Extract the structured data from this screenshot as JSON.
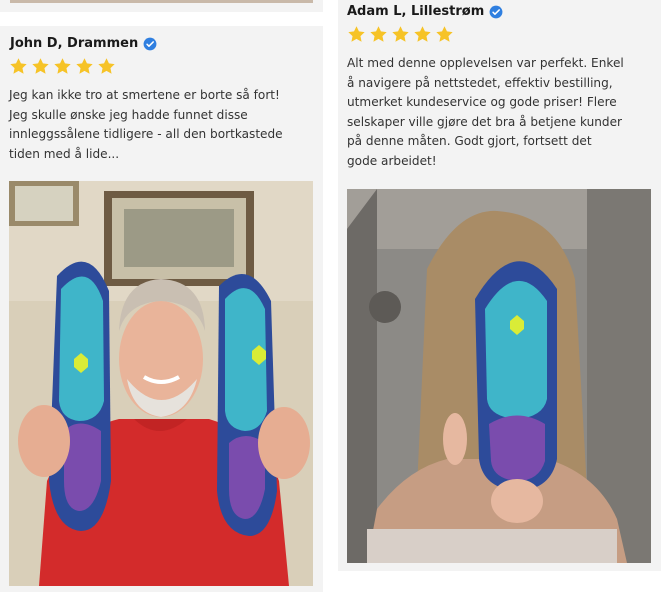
{
  "colors": {
    "card_bg": "#f3f3f3",
    "star": "#f6c327",
    "verified_badge": "#2f7fe0",
    "text": "#333333"
  },
  "reviews": [
    {
      "name": "John D, Drammen",
      "rating": 5,
      "verified_icon": "verified-badge-icon",
      "lines": [
        "Jeg kan ikke tro at smertene er borte så fort!",
        "Jeg skulle ønske jeg hadde funnet disse",
        "innleggssålene tidligere - all den bortkastede",
        "tiden med å lide..."
      ],
      "photo_alt": "man holding two insoles"
    },
    {
      "name": "Adam L, Lillestrøm",
      "rating": 5,
      "verified_icon": "verified-badge-icon",
      "lines": [
        "Alt med denne opplevelsen var perfekt. Enkel",
        "å navigere på nettstedet, effektiv bestilling,",
        "utmerket kundeservice og gode priser! Flere",
        "selskaper ville gjøre det bra å betjene kunder",
        "på denne måten. Godt gjort, fortsett det",
        "gode arbeidet!"
      ],
      "photo_alt": "woman holding insole in front of face"
    }
  ]
}
